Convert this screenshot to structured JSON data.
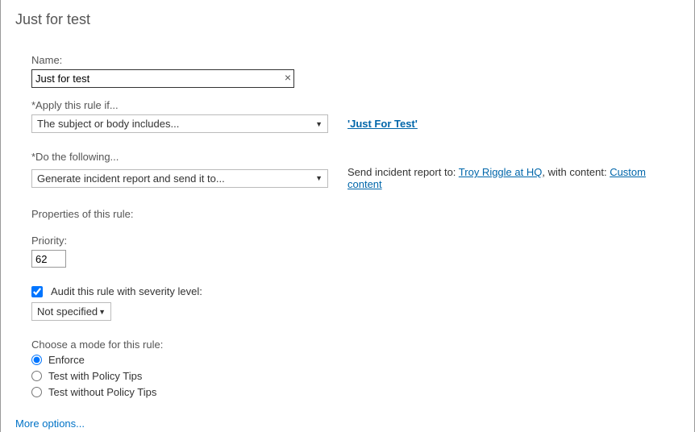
{
  "title": "Just for test",
  "name": {
    "label": "Name:",
    "value": "Just for test"
  },
  "applyIf": {
    "label": "*Apply this rule if...",
    "selected": "The subject or body includes...",
    "valueLink": "'Just For Test'"
  },
  "doFollowing": {
    "label": "*Do the following...",
    "selected": "Generate incident report and send it to...",
    "descPrefix": "Send incident report to: ",
    "recipient": "Troy Riggle at HQ",
    "descMiddle": ", with content: ",
    "content": "Custom content"
  },
  "properties": {
    "label": "Properties of this rule:"
  },
  "priority": {
    "label": "Priority:",
    "value": "62"
  },
  "audit": {
    "label": "Audit this rule with severity level:",
    "selected": "Not specified"
  },
  "mode": {
    "label": "Choose a mode for this rule:",
    "options": {
      "enforce": "Enforce",
      "testWith": "Test with Policy Tips",
      "testWithout": "Test without Policy Tips"
    }
  },
  "moreOptions": "More options..."
}
